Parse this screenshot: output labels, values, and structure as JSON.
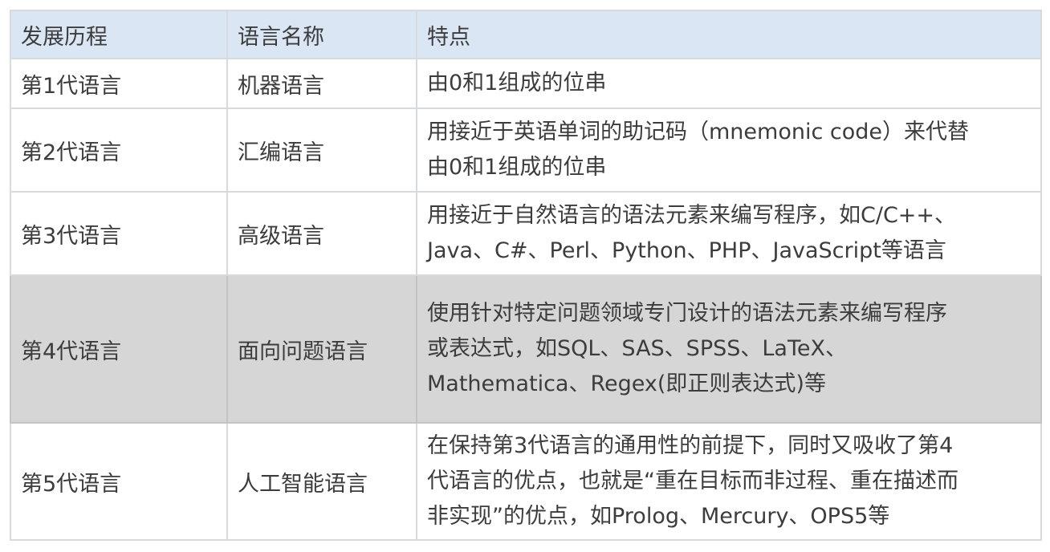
{
  "table": {
    "headers": [
      "发展历程",
      "语言名称",
      "特点"
    ],
    "rows": [
      {
        "stage": "第1代语言",
        "name": "机器语言",
        "desc": [
          "由0和1组成的位串"
        ]
      },
      {
        "stage": "第2代语言",
        "name": "汇编语言",
        "desc": [
          "用接近于英语单词的助记码（mnemonic code）来代替",
          "由0和1组成的位串"
        ]
      },
      {
        "stage": "第3代语言",
        "name": "高级语言",
        "desc": [
          "用接近于自然语言的语法元素来编写程序，如C/C++、",
          "Java、C#、Perl、Python、PHP、JavaScript等语言"
        ]
      },
      {
        "stage": "第4代语言",
        "name": "面向问题语言",
        "desc": [
          "使用针对特定问题领域专门设计的语法元素来编写程序",
          "或表达式，如SQL、SAS、SPSS、LaTeX、",
          "Mathematica、Regex(即正则表达式)等"
        ],
        "highlighted": true
      },
      {
        "stage": "第5代语言",
        "name": "人工智能语言",
        "desc": [
          "在保持第3代语言的通用性的前提下，同时又吸收了第4",
          "代语言的优点，也就是“重在目标而非过程、重在描述而",
          "非实现”的优点，如Prolog、Mercury、OPS5等"
        ]
      }
    ],
    "colors": {
      "header_bg": "#dbe6f4",
      "highlight_row_bg": "#d6d6d6",
      "border": "#d7dbe0"
    }
  }
}
